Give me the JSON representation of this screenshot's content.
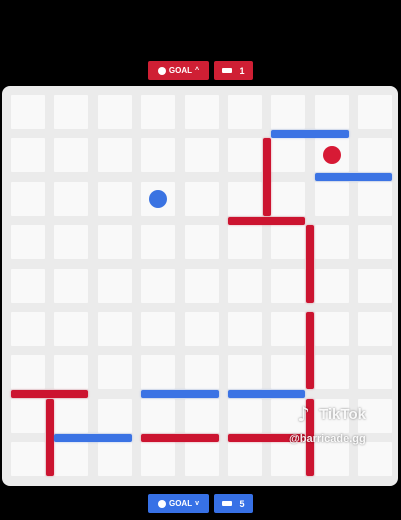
{
  "top_bar": {
    "goal_label": "GOAL",
    "goal_chevron": "^",
    "goal_color": "#cf1f34",
    "walls_count": "1",
    "walls_color": "#cf1f34"
  },
  "bottom_bar": {
    "goal_label": "GOAL",
    "goal_chevron": "v",
    "goal_color": "#3771e6",
    "walls_count": "5",
    "walls_color": "#3771e6"
  },
  "board": {
    "rows": 9,
    "cols": 9,
    "red_pawn": {
      "row": 1,
      "col": 7
    },
    "blue_pawn": {
      "row": 2,
      "col": 3
    },
    "walls": [
      {
        "color": "blue",
        "orientation": "h",
        "row": 1,
        "col": 6,
        "length": 2
      },
      {
        "color": "blue",
        "orientation": "h",
        "row": 2,
        "col": 7,
        "length": 2
      },
      {
        "color": "red",
        "orientation": "v",
        "row": 1,
        "col": 6,
        "length": 2
      },
      {
        "color": "red",
        "orientation": "h",
        "row": 3,
        "col": 5,
        "length": 2
      },
      {
        "color": "red",
        "orientation": "v",
        "row": 3,
        "col": 7,
        "length": 2
      },
      {
        "color": "red",
        "orientation": "v",
        "row": 5,
        "col": 7,
        "length": 2
      },
      {
        "color": "red",
        "orientation": "h",
        "row": 7,
        "col": 0,
        "length": 2
      },
      {
        "color": "red",
        "orientation": "v",
        "row": 7,
        "col": 1,
        "length": 2
      },
      {
        "color": "blue",
        "orientation": "h",
        "row": 7,
        "col": 3,
        "length": 2
      },
      {
        "color": "blue",
        "orientation": "h",
        "row": 7,
        "col": 5,
        "length": 2
      },
      {
        "color": "blue",
        "orientation": "h",
        "row": 8,
        "col": 1,
        "length": 2
      },
      {
        "color": "red",
        "orientation": "h",
        "row": 8,
        "col": 3,
        "length": 2
      },
      {
        "color": "red",
        "orientation": "h",
        "row": 8,
        "col": 5,
        "length": 2
      },
      {
        "color": "red",
        "orientation": "v",
        "row": 7,
        "col": 7,
        "length": 2
      }
    ]
  },
  "watermark": {
    "logo": "♪",
    "brand": "TikTok",
    "handle": "@barricade.gg"
  }
}
